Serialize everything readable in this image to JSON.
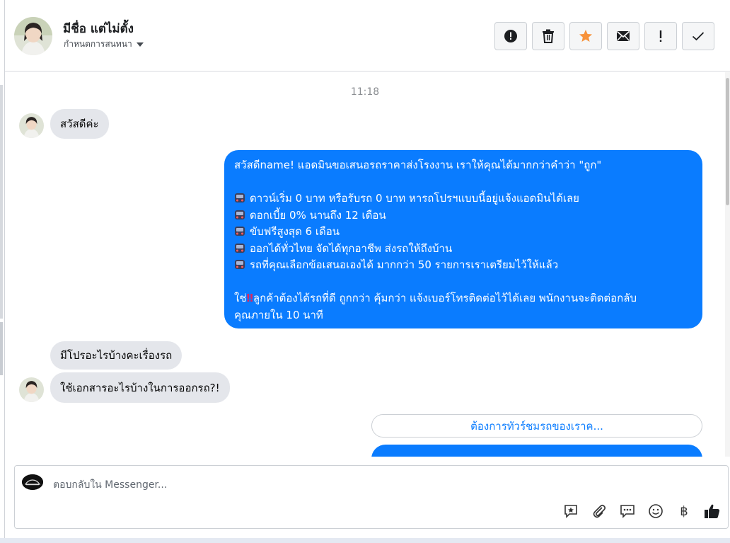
{
  "header": {
    "name": "มีชื่อ แต่ไม่ตั้ง",
    "subtitle": "กำหนดการสนทนา",
    "actions": [
      {
        "id": "report",
        "icon": "alert-circle-icon"
      },
      {
        "id": "delete",
        "icon": "trash-icon"
      },
      {
        "id": "star",
        "icon": "star-icon"
      },
      {
        "id": "mail",
        "icon": "envelope-icon"
      },
      {
        "id": "important",
        "icon": "exclamation-icon"
      },
      {
        "id": "done",
        "icon": "checkmark-icon"
      }
    ]
  },
  "chat": {
    "timestamp": "11:18",
    "msg1": "สวัสดีค่ะ",
    "out_lines": [
      "สวัสดีname! แอดมินขอเสนอรถราคาส่งโรงงาน เราให้คุณได้มากกว่าคำว่า \"ถูก\"",
      "",
      "ดาวน์เริ่ม 0 บาท หรือรับรถ 0 บาท หารถโปรฯแบบนี้อยู่แจ้งแอดมินได้เลย",
      "ดอกเบี้ย 0% นานถึง 12 เดือน",
      "ขับฟรีสูงสุด 6 เดือน",
      "ออกได้ทั่วไทย จัดได้ทุกอาชีพ ส่งรถให้ถึงบ้าน",
      "รถที่คุณเลือกข้อเสนอเองได้ มากกว่า 50 รายการเราเตรียมไว้ให้แล้ว",
      "",
      "ใช่",
      "ลูกค้าต้องได้รถที่ดี ถูกกว่า คุ้มกว่า แจ้งเบอร์โทรติดต่อไว้ได้เลย พนักงานจะติดต่อกลับ",
      "คุณภายใน 10 นาที"
    ],
    "msg2": "มีโปรอะไรบ้างคะเรื่องรถ",
    "msg3": "ใช้เอกสารอะไรบ้างในการออกรถ?!",
    "quick_reply": "ต้องการทัวร์ชมรถของเราค...",
    "colors": {
      "outgoing": "#0a7cff",
      "incoming": "#e4e6eb",
      "star": "#f7923a"
    }
  },
  "composer": {
    "placeholder": "ตอบกลับใน Messenger...",
    "tools": [
      "sticker-star-icon",
      "paperclip-icon",
      "saved-reply-icon",
      "emoji-icon",
      "baht-icon",
      "thumbs-up-icon"
    ],
    "baht_symbol": "฿"
  }
}
